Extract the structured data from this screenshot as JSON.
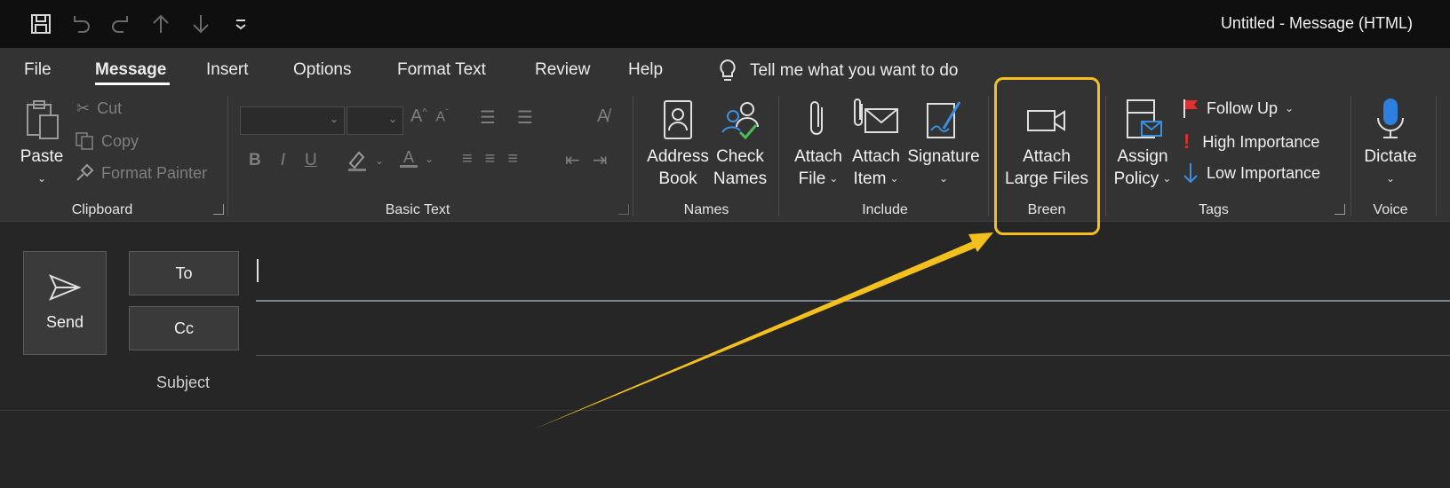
{
  "window": {
    "title": "Untitled  -  Message (HTML)"
  },
  "qat": {
    "icons": [
      "save-icon",
      "undo-icon",
      "redo-icon",
      "up-arrow-icon",
      "down-arrow-icon",
      "customize-qat-icon"
    ]
  },
  "tabs": [
    {
      "label": "File"
    },
    {
      "label": "Message"
    },
    {
      "label": "Insert"
    },
    {
      "label": "Options"
    },
    {
      "label": "Format Text"
    },
    {
      "label": "Review"
    },
    {
      "label": "Help"
    }
  ],
  "tellme": {
    "label": "Tell me what you want to do"
  },
  "ribbon": {
    "clipboard": {
      "label": "Clipboard",
      "paste": "Paste",
      "cut": "Cut",
      "copy": "Copy",
      "format_painter": "Format Painter"
    },
    "basic_text": {
      "label": "Basic Text",
      "bold": "B",
      "italic": "I",
      "underline": "U",
      "font_color": "A"
    },
    "names": {
      "label": "Names",
      "address_book_1": "Address",
      "address_book_2": "Book",
      "check_names_1": "Check",
      "check_names_2": "Names"
    },
    "include": {
      "label": "Include",
      "attach_file_1": "Attach",
      "attach_file_2": "File",
      "attach_item_1": "Attach",
      "attach_item_2": "Item",
      "signature": "Signature"
    },
    "breen": {
      "label": "Breen",
      "attach_large_1": "Attach",
      "attach_large_2": "Large Files"
    },
    "tags": {
      "label": "Tags",
      "assign_policy_1": "Assign",
      "assign_policy_2": "Policy",
      "follow_up": "Follow Up",
      "high_importance": "High Importance",
      "low_importance": "Low Importance"
    },
    "voice": {
      "label": "Voice",
      "dictate": "Dictate"
    }
  },
  "compose": {
    "send": "Send",
    "to": "To",
    "cc": "Cc",
    "subject": "Subject"
  },
  "colors": {
    "highlight": "#f4c01d",
    "follow_up_flag": "#e03030",
    "high_importance": "#e03030",
    "low_importance": "#3a8fe0",
    "dictate_mic": "#2f7fe0"
  }
}
